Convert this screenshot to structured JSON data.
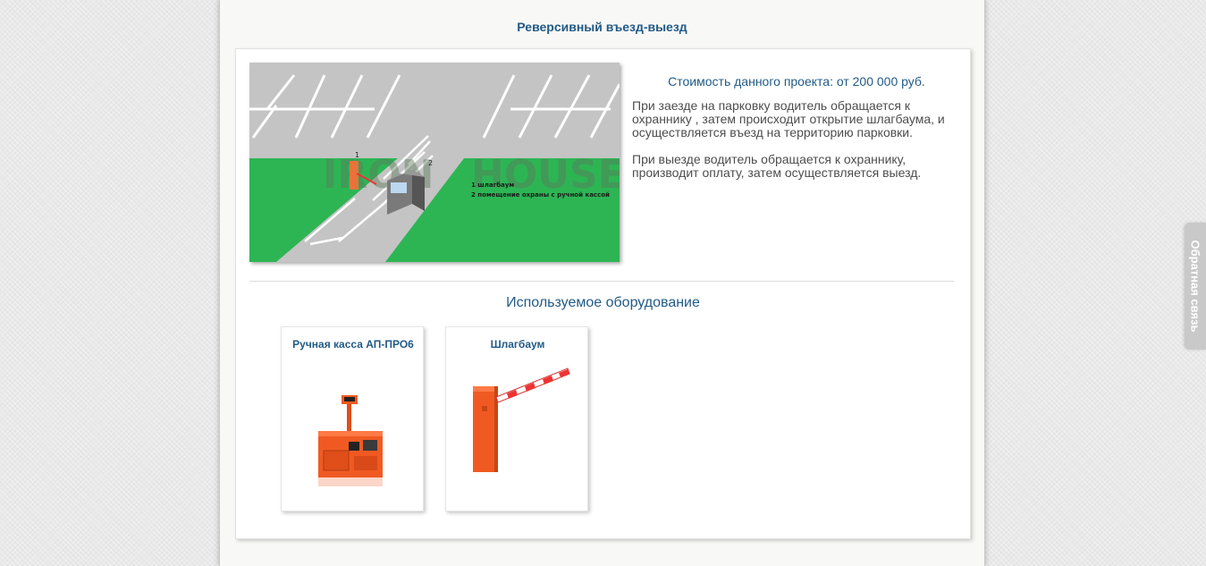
{
  "page": {
    "title": "Реверсивный въезд-выезд"
  },
  "project": {
    "cost": "Стоимость данного проекта: от 200 000 руб.",
    "paragraphs": [
      "При заезде на парковку водитель обращается к охраннику , затем происходит открытие шлагбаума, и осуществляется въезд на территорию парковки.",
      "При выезде водитель обращается к охраннику, производит оплату, затем осуществляется выезд."
    ]
  },
  "scheme": {
    "marker_1": "1",
    "marker_2": "2",
    "legend": [
      "1 шлагбаум",
      "2 помещение охраны с ручной кассой"
    ],
    "watermark_left": "IRON",
    "watermark_right": "HOUSE"
  },
  "equipment": {
    "title": "Используемое оборудование",
    "items": [
      {
        "name": "Ручная касса АП-ПРО6",
        "icon": "cash-register-image"
      },
      {
        "name": "Шлагбаум",
        "icon": "barrier-image"
      }
    ]
  },
  "feedback": {
    "label": "Обратная связь"
  },
  "colors": {
    "accent": "#225b86",
    "grass": "#2db554",
    "asphalt": "#c4c4c4",
    "equipment_orange": "#f05a22"
  }
}
